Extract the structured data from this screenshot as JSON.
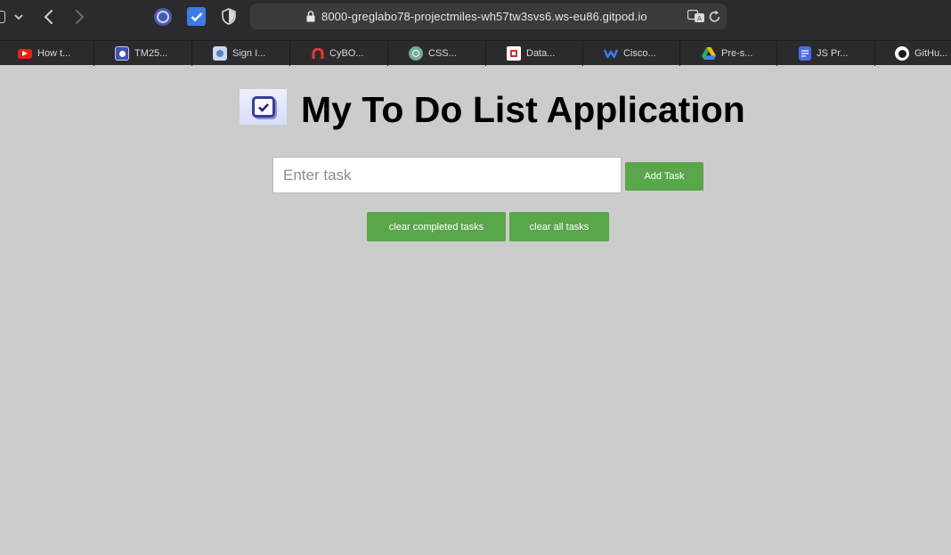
{
  "browser": {
    "url": "8000-greglabo78-projectmiles-wh57tw3svs6.ws-eu86.gitpod.io"
  },
  "bookmarks": [
    {
      "label": "How t...",
      "icon": "youtube-icon",
      "color": "#e62117"
    },
    {
      "label": "TM25...",
      "icon": "app-icon",
      "color": "#3f51b5"
    },
    {
      "label": "Sign I...",
      "icon": "profile-icon",
      "color": "#7fa3d8"
    },
    {
      "label": "CyBO...",
      "icon": "magnet-icon",
      "color": "#e53935"
    },
    {
      "label": "CSS...",
      "icon": "chatgpt-icon",
      "color": "#74aa9c"
    },
    {
      "label": "Data...",
      "icon": "data-icon",
      "color": "#d32f2f"
    },
    {
      "label": "Cisco...",
      "icon": "webex-icon",
      "color": "#3b7cf0"
    },
    {
      "label": "Pre-s...",
      "icon": "google-drive-icon",
      "color": "#34a853"
    },
    {
      "label": "JS Pr...",
      "icon": "google-docs-icon",
      "color": "#4a6cf0"
    },
    {
      "label": "GitHu...",
      "icon": "github-icon",
      "color": "#ffffff"
    }
  ],
  "app": {
    "title": "My To Do List Application",
    "task_input": {
      "placeholder": "Enter task",
      "value": ""
    },
    "add_button": "Add Task",
    "clear_completed_button": "clear completed tasks",
    "clear_all_button": "clear all tasks"
  },
  "colors": {
    "accent": "#5aa64a",
    "page_background": "#cccccc",
    "chrome_background": "#2b2b2d"
  }
}
